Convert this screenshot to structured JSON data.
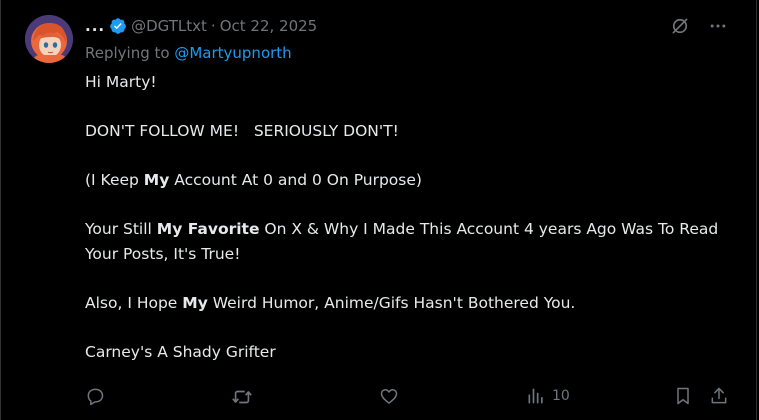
{
  "post": {
    "display_name": "...",
    "handle": "@DGTLtxt",
    "separator": "·",
    "date": "Oct 22, 2025",
    "replying_prefix": "Replying to ",
    "replying_to": "@Martyupnorth",
    "body": {
      "greeting": "Hi Marty!",
      "line2": "DON'T FOLLOW ME!   SERIOUSLY DON'T!",
      "line3_a": "(I Keep ",
      "line3_b": "My",
      "line3_c": " Account At 0 and 0 On Purpose)",
      "line4_a": "Your Still ",
      "line4_b": "My Favorite",
      "line4_c": " On X & Why I Made This Account 4 years Ago Was To Read Your Posts, It's True!",
      "line5_a": "Also, I Hope ",
      "line5_b": "My",
      "line5_c": " Weird Humor, Anime/Gifs Hasn't Bothered You.",
      "line6": "Carney's A Shady Grifter"
    },
    "views": "10"
  },
  "colors": {
    "background": "#000000",
    "text": "#e7e9ea",
    "muted": "#71767b",
    "accent": "#1d9bf0"
  },
  "icons": {
    "verified": "verified-badge-icon",
    "grok": "grok-icon",
    "more": "more-icon",
    "reply": "reply-icon",
    "repost": "repost-icon",
    "like": "like-icon",
    "views": "views-icon",
    "bookmark": "bookmark-icon",
    "share": "share-icon"
  }
}
